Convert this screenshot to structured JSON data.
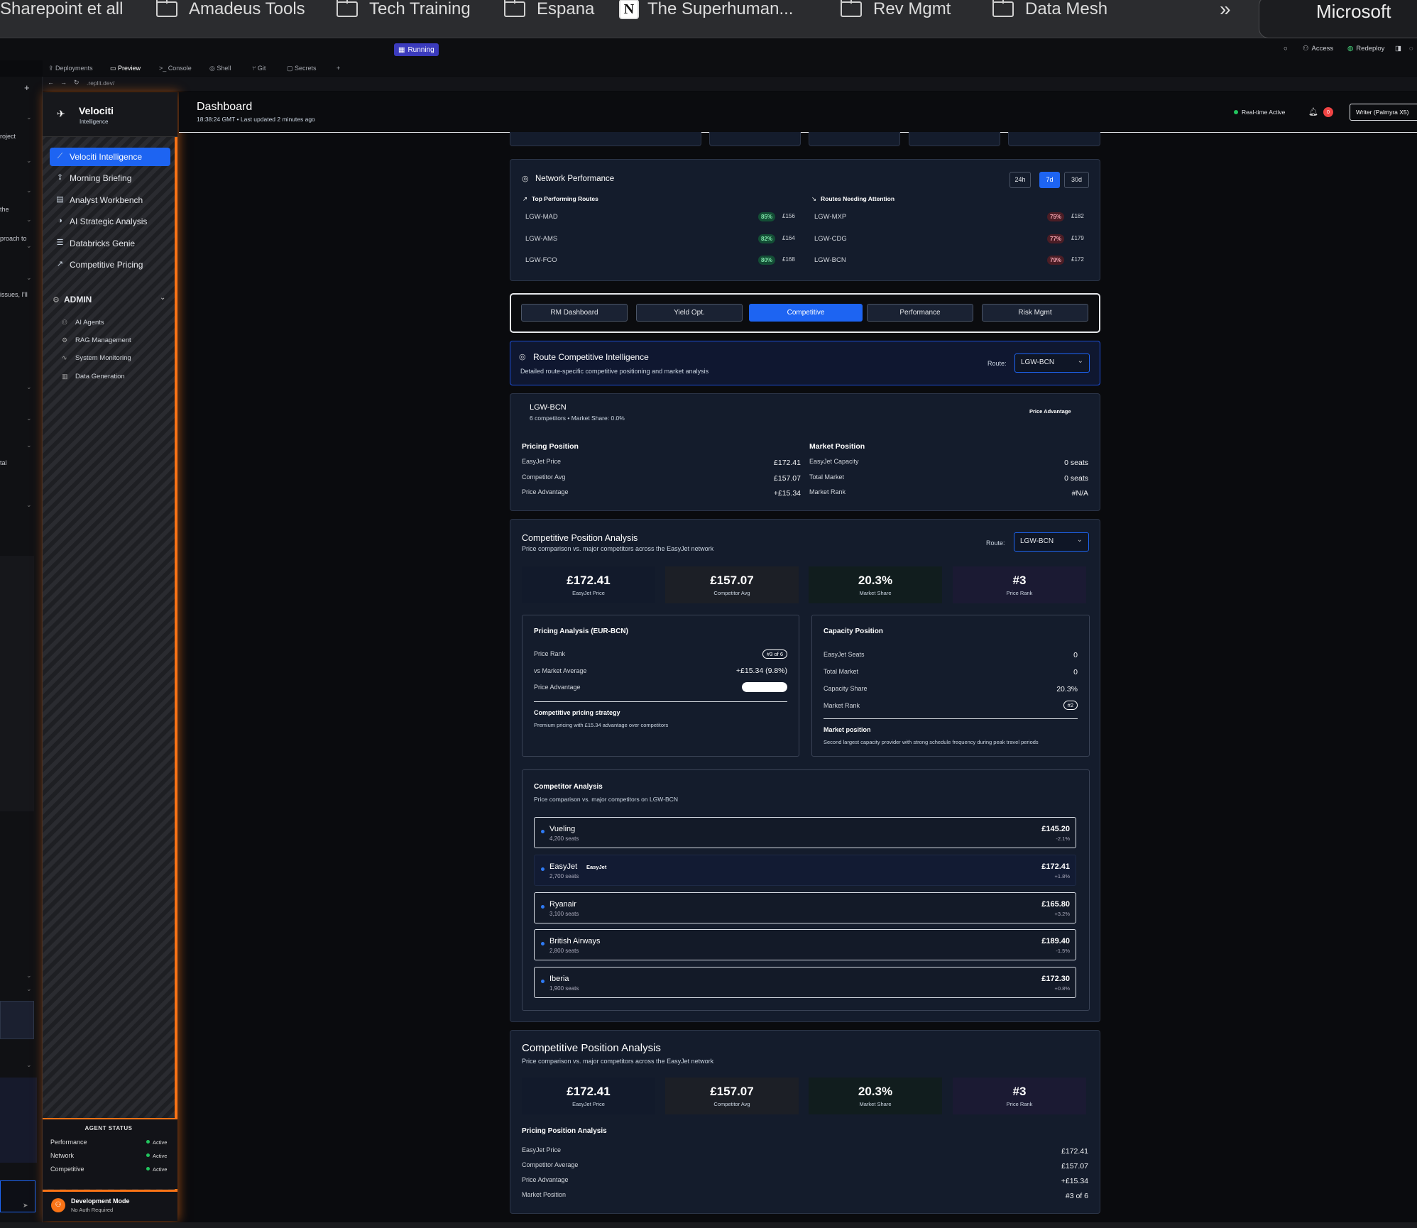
{
  "bookmarks": [
    {
      "label": "Sharepoint et all",
      "type": "folder"
    },
    {
      "label": "Amadeus Tools",
      "type": "folder"
    },
    {
      "label": "Tech Training",
      "type": "folder"
    },
    {
      "label": "Espana",
      "type": "folder"
    },
    {
      "label": "The Superhuman...",
      "type": "notion"
    },
    {
      "label": "Rev Mgmt",
      "type": "folder"
    },
    {
      "label": "Data Mesh",
      "type": "folder"
    }
  ],
  "bookmarks_more": "»",
  "profile_label": "Microsoft",
  "replit": {
    "status": "Running",
    "tools": {
      "access": "Access",
      "redeploy": "Redeploy"
    },
    "tabs": [
      "Deployments",
      "Preview",
      "Console",
      "Shell",
      "Git",
      "Secrets",
      "+"
    ],
    "url": ".replit.dev/",
    "chat_fragments": [
      "roject",
      "the",
      "proach to",
      "issues, I'll",
      "tal"
    ]
  },
  "sidebar": {
    "app_name": "Velociti",
    "app_sub": "Intelligence",
    "items": [
      {
        "label": "Velociti Intelligence",
        "icon": "chart-line-icon",
        "active": true
      },
      {
        "label": "Morning Briefing",
        "icon": "upload-icon",
        "active": false
      },
      {
        "label": "Analyst Workbench",
        "icon": "clipboard-icon",
        "active": false
      },
      {
        "label": "AI Strategic Analysis",
        "icon": "brain-icon",
        "active": false
      },
      {
        "label": "Databricks Genie",
        "icon": "database-icon",
        "active": false
      },
      {
        "label": "Competitive Pricing",
        "icon": "trending-up-icon",
        "active": false
      }
    ],
    "admin_label": "ADMIN",
    "admin_items": [
      {
        "label": "AI Agents",
        "icon": "users-icon"
      },
      {
        "label": "RAG Management",
        "icon": "settings-icon"
      },
      {
        "label": "System Monitoring",
        "icon": "activity-icon"
      },
      {
        "label": "Data Generation",
        "icon": "bar-chart-icon"
      }
    ],
    "agent_status": {
      "title": "AGENT STATUS",
      "rows": [
        {
          "name": "Performance",
          "status": "Active"
        },
        {
          "name": "Network",
          "status": "Active"
        },
        {
          "name": "Competitive",
          "status": "Active"
        }
      ]
    },
    "dev_mode": {
      "title": "Development Mode",
      "sub": "No Auth Required"
    }
  },
  "header": {
    "title": "Dashboard",
    "subtitle": "18:38:24 GMT • Last updated 2 minutes ago",
    "realtime": "Real-time Active",
    "notif_count": "0",
    "model": "Writer (Palmyra X5)"
  },
  "network": {
    "title": "Network Performance",
    "periods": [
      "24h",
      "7d",
      "30d"
    ],
    "active_period": "7d",
    "top_title": "Top Performing Routes",
    "attn_title": "Routes Needing Attention",
    "top": [
      {
        "route": "LGW-MAD",
        "pct": "85%",
        "price": "£156"
      },
      {
        "route": "LGW-AMS",
        "pct": "82%",
        "price": "£164"
      },
      {
        "route": "LGW-FCO",
        "pct": "80%",
        "price": "£168"
      }
    ],
    "attention": [
      {
        "route": "LGW-MXP",
        "pct": "75%",
        "price": "£182"
      },
      {
        "route": "LGW-CDG",
        "pct": "77%",
        "price": "£179"
      },
      {
        "route": "LGW-BCN",
        "pct": "79%",
        "price": "£172"
      }
    ]
  },
  "tabs": [
    "RM Dashboard",
    "Yield Opt.",
    "Competitive",
    "Performance",
    "Risk Mgmt"
  ],
  "active_tab": "Competitive",
  "route_ci": {
    "title": "Route Competitive Intelligence",
    "sub": "Detailed route-specific competitive positioning and market analysis",
    "route_label": "Route:",
    "route": "LGW-BCN"
  },
  "route_card": {
    "route": "LGW-BCN",
    "meta": "6 competitors • Market Share: 0.0%",
    "badge": "Price Advantage",
    "pricing_title": "Pricing Position",
    "pricing": [
      {
        "label": "EasyJet Price",
        "value": "£172.41"
      },
      {
        "label": "Competitor Avg",
        "value": "£157.07"
      },
      {
        "label": "Price Advantage",
        "value": "+£15.34"
      }
    ],
    "market_title": "Market Position",
    "market": [
      {
        "label": "EasyJet Capacity",
        "value": "0 seats"
      },
      {
        "label": "Total Market",
        "value": "0 seats"
      },
      {
        "label": "Market Rank",
        "value": "#N/A"
      }
    ]
  },
  "cpa": {
    "title": "Competitive Position Analysis",
    "sub": "Price comparison vs. major competitors across the EasyJet network",
    "route_label": "Route:",
    "route": "LGW-BCN",
    "kpis": [
      {
        "value": "£172.41",
        "caption": "EasyJet Price",
        "bg": "#121a2b"
      },
      {
        "value": "£157.07",
        "caption": "Competitor Avg",
        "bg": "#1c1f26"
      },
      {
        "value": "20.3%",
        "caption": "Market Share",
        "bg": "#111d1e"
      },
      {
        "value": "#3",
        "caption": "Price Rank",
        "bg": "#1b1a33"
      }
    ],
    "pricing_analysis": {
      "title": "Pricing Analysis (EUR-BCN)",
      "rows": [
        {
          "label": "Price Rank",
          "value": "#3 of 6"
        },
        {
          "label": "vs Market Average",
          "value": "+£15.34 (9.8%)"
        },
        {
          "label": "Price Advantage",
          "value": ""
        }
      ],
      "price_advantage_level": 1.0,
      "strategy_title": "Competitive pricing strategy",
      "strategy_text": "Premium pricing with £15.34 advantage over competitors"
    },
    "capacity": {
      "title": "Capacity Position",
      "rows": [
        {
          "label": "EasyJet Seats",
          "value": "0"
        },
        {
          "label": "Total Market",
          "value": "0"
        },
        {
          "label": "Capacity Share",
          "value": "20.3%"
        },
        {
          "label": "Market Rank",
          "value": "#2"
        }
      ],
      "pos_title": "Market position",
      "pos_text": "Second largest capacity provider with strong schedule frequency during peak travel periods"
    },
    "competitors": {
      "title": "Competitor Analysis",
      "sub": "Price comparison vs. major competitors on LGW-BCN",
      "rows": [
        {
          "name": "Vueling",
          "seats": "4,200 seats",
          "price": "£145.20",
          "change": "-2.1%",
          "tag": ""
        },
        {
          "name": "EasyJet",
          "seats": "2,700 seats",
          "price": "£172.41",
          "change": "+1.8%",
          "tag": "EasyJet"
        },
        {
          "name": "Ryanair",
          "seats": "3,100 seats",
          "price": "£165.80",
          "change": "+3.2%",
          "tag": ""
        },
        {
          "name": "British Airways",
          "seats": "2,800 seats",
          "price": "£189.40",
          "change": "-1.5%",
          "tag": ""
        },
        {
          "name": "Iberia",
          "seats": "1,900 seats",
          "price": "£172.30",
          "change": "+0.8%",
          "tag": ""
        }
      ]
    }
  },
  "cpa2": {
    "title": "Competitive Position Analysis",
    "sub": "Price comparison vs. major competitors across the EasyJet network",
    "kpis": [
      {
        "value": "£172.41",
        "caption": "EasyJet Price",
        "bg": "#121a2b"
      },
      {
        "value": "£157.07",
        "caption": "Competitor Avg",
        "bg": "#1c1f26"
      },
      {
        "value": "20.3%",
        "caption": "Market Share",
        "bg": "#111d1e"
      },
      {
        "value": "#3",
        "caption": "Price Rank",
        "bg": "#1b1a33"
      }
    ],
    "ppa_title": "Pricing Position Analysis",
    "rows": [
      {
        "label": "EasyJet Price",
        "value": "£172.41"
      },
      {
        "label": "Competitor Average",
        "value": "£157.07"
      },
      {
        "label": "Price Advantage",
        "value": "+£15.34"
      },
      {
        "label": "Market Position",
        "value": "#3 of 6"
      }
    ]
  },
  "colors": {
    "accent": "#1d64f2",
    "orange": "#f97316",
    "green": "#22c55e",
    "red": "#ef4444"
  }
}
